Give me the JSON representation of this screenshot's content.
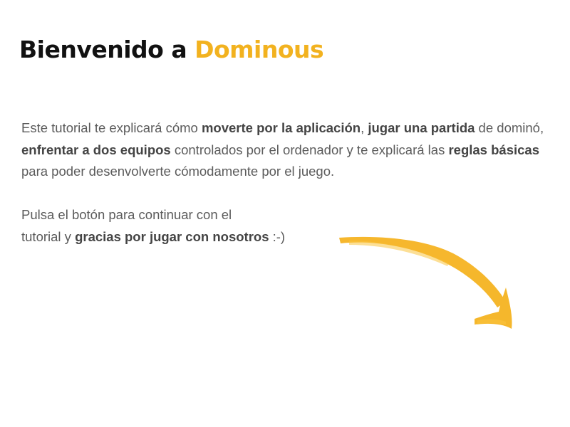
{
  "header": {
    "title_prefix": "Bienvenido a",
    "title_brand": "Dominous"
  },
  "intro": {
    "t1": "Este tutorial te explicará cómo ",
    "b1": "moverte por la aplicación",
    "t2": ", ",
    "b2": "jugar una partida",
    "t3": " de dominó, ",
    "b3": "enfrentar a dos equipos",
    "t4": " controlados por el ordenador y te explicará las ",
    "b4": "reglas básicas",
    "t5": " para poder desenvolverte cómodamente por el juego."
  },
  "continue": {
    "line1": "Pulsa el botón para continuar con el",
    "t2": "tutorial y ",
    "b1": "gracias por jugar con nosotros",
    "t3": " :-)"
  },
  "arrow": {
    "icon": "curved-arrow-down-right-icon",
    "color": "#f5b21d"
  }
}
